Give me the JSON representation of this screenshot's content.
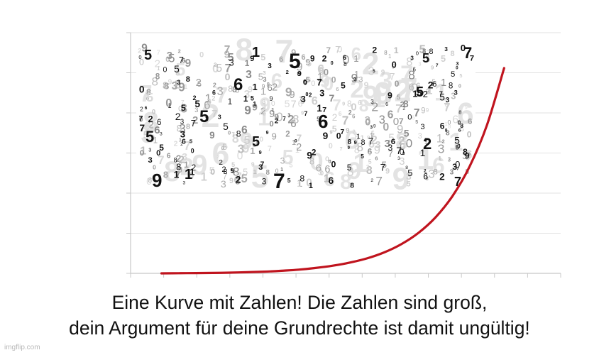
{
  "caption": {
    "line1": "Eine Kurve mit Zahlen! Die Zahlen sind groß,",
    "line2": "dein Argument für deine Grundrechte ist damit ungültig!"
  },
  "watermark": "imgflip.com",
  "colors": {
    "curve": "#c0141e",
    "grid": "#e2e2e2",
    "axis": "#c8c8c8",
    "digits_dark": "#111111",
    "digits_light": "#a6a6a6"
  },
  "digit_texture": {
    "digits": [
      "5",
      "1",
      "6",
      "7",
      "2",
      "8",
      "9",
      "0",
      "3"
    ],
    "large_dark": [
      "5",
      "1",
      "5",
      "6",
      "5",
      "6",
      "5",
      "7",
      "5",
      "7",
      "5",
      "9",
      "5",
      "2",
      "7",
      "1"
    ]
  },
  "chart_data": {
    "type": "line",
    "series": [
      {
        "x": [
          0,
          1,
          2,
          3,
          4,
          5,
          6,
          7,
          8,
          9,
          10,
          11,
          12,
          13,
          14,
          15,
          16,
          17,
          18,
          19,
          20
        ],
        "values": [
          0.0,
          0.1,
          0.2,
          0.3,
          0.5,
          0.8,
          1.2,
          1.8,
          2.6,
          3.8,
          5.4,
          7.6,
          10.6,
          14.8,
          20.6,
          28.6,
          39.6,
          54.8,
          75.8,
          104.8,
          145.0
        ]
      }
    ],
    "xlim": [
      -1.8,
      23.3
    ],
    "ylim": [
      0,
      170
    ],
    "grid": true,
    "legend": "none"
  }
}
